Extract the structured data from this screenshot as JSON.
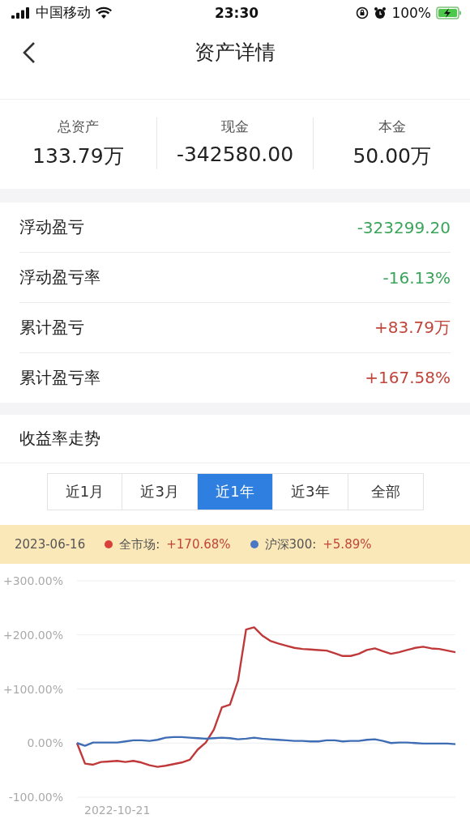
{
  "status_bar": {
    "carrier": "中国移动",
    "time": "23:30",
    "battery": "100%"
  },
  "header": {
    "title": "资产详情"
  },
  "summary": [
    {
      "label": "总资产",
      "value": "133.79万"
    },
    {
      "label": "现金",
      "value": "-342580.00"
    },
    {
      "label": "本金",
      "value": "50.00万"
    }
  ],
  "metrics": [
    {
      "label": "浮动盈亏",
      "value": "-323299.20",
      "color": "#3aa55a"
    },
    {
      "label": "浮动盈亏率",
      "value": "-16.13%",
      "color": "#3aa55a"
    },
    {
      "label": "累计盈亏",
      "value": "+83.79万",
      "color": "#c0463c"
    },
    {
      "label": "累计盈亏率",
      "value": "+167.58%",
      "color": "#c0463c"
    }
  ],
  "trend_section": {
    "title": "收益率走势",
    "ranges": [
      {
        "label": "近1月",
        "selected": false
      },
      {
        "label": "近3月",
        "selected": false
      },
      {
        "label": "近1年",
        "selected": true
      },
      {
        "label": "近3年",
        "selected": false
      },
      {
        "label": "全部",
        "selected": false
      }
    ],
    "legend": {
      "date": "2023-06-16",
      "items": [
        {
          "name": "全市场:",
          "value": "+170.68%",
          "color": "#d9403a"
        },
        {
          "name": "沪深300:",
          "value": "+5.89%",
          "color": "#4a78c4"
        }
      ]
    },
    "chart_data": {
      "type": "line",
      "categories": [
        null,
        null,
        null,
        null,
        null,
        "2022-10-21",
        null,
        null,
        null,
        null,
        null,
        null,
        null,
        null,
        null,
        null,
        null,
        null,
        null,
        null,
        null,
        null,
        null,
        null,
        null,
        null,
        null,
        null,
        null,
        null,
        null,
        null,
        null,
        null,
        null,
        null,
        null,
        null,
        null,
        null,
        null,
        null,
        null,
        null,
        null,
        null,
        null,
        null
      ],
      "ylim": [
        -100,
        300
      ],
      "yticks": [
        {
          "value": 300,
          "label": "+300.00%"
        },
        {
          "value": 200,
          "label": "+200.00%"
        },
        {
          "value": 100,
          "label": "+100.00%"
        },
        {
          "value": 0,
          "label": "0.00%"
        },
        {
          "value": -100,
          "label": "-100.00%"
        }
      ],
      "series": [
        {
          "color": "#c0393a",
          "values": [
            0,
            -38,
            -40,
            -35,
            -34,
            -33,
            -35,
            -33,
            -36,
            -41,
            -44,
            -42,
            -39,
            -36,
            -31,
            -12,
            1,
            25,
            66,
            71,
            115,
            210,
            214,
            199,
            189,
            184,
            180,
            176,
            174,
            173,
            172,
            171,
            166,
            161,
            161,
            165,
            172,
            175,
            170,
            165,
            168,
            172,
            176,
            178,
            175,
            174,
            171,
            168
          ]
        },
        {
          "color": "#3f6db5",
          "values": [
            0,
            -5,
            1,
            1,
            1,
            1,
            3,
            5,
            5,
            4,
            6,
            10,
            11,
            11,
            10,
            9,
            8,
            9,
            10,
            9,
            7,
            8,
            10,
            8,
            7,
            6,
            5,
            4,
            4,
            3,
            3,
            5,
            5,
            3,
            4,
            4,
            6,
            7,
            4,
            0,
            1,
            1,
            0,
            -1,
            -1,
            -1,
            -1,
            -2
          ]
        }
      ],
      "grid": true
    }
  }
}
